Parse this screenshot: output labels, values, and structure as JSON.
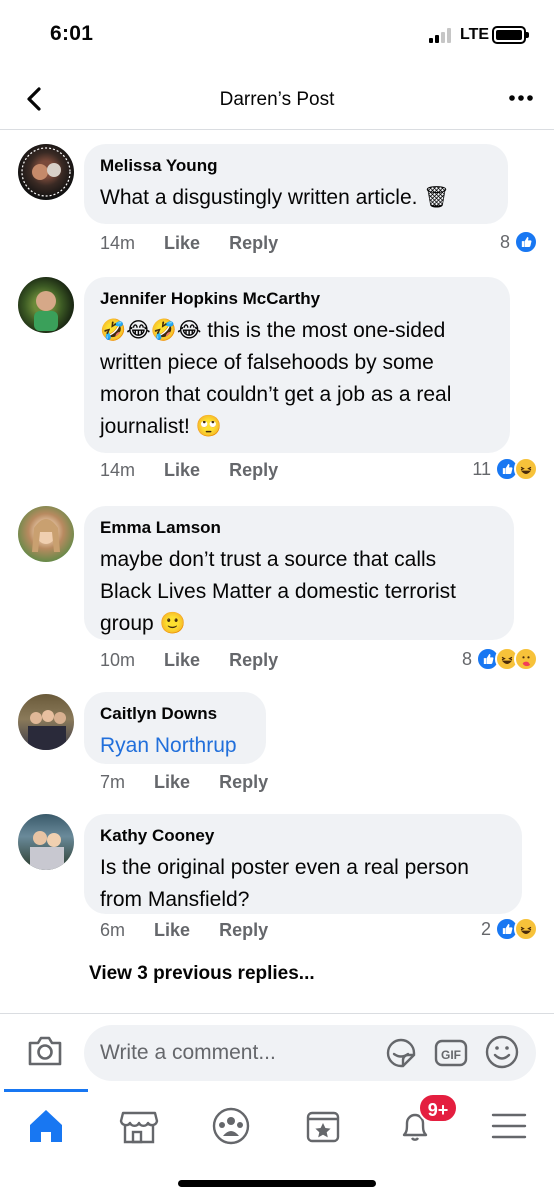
{
  "status_bar": {
    "time": "6:01",
    "network": "LTE"
  },
  "header": {
    "title": "Darren’s Post"
  },
  "comments": [
    {
      "author": "Melissa Young",
      "text": "What a disgustingly written article. 🗑",
      "time": "14m",
      "like_label": "Like",
      "reply_label": "Reply",
      "reaction_count": "8",
      "reactions": [
        "like"
      ]
    },
    {
      "author": "Jennifer Hopkins McCarthy",
      "text_line1": "this is the most one-sided",
      "text_line2": "written piece of falsehoods by some",
      "text_line3": "moron that couldn’t get a job as a real",
      "text_line4": "journalist!",
      "time": "14m",
      "like_label": "Like",
      "reply_label": "Reply",
      "reaction_count": "11",
      "reactions": [
        "like",
        "haha"
      ]
    },
    {
      "author": "Emma Lamson",
      "text_line1": "maybe don’t trust a source that calls",
      "text_line2": "Black Lives Matter a domestic terrorist",
      "text_line3": "group",
      "time": "10m",
      "like_label": "Like",
      "reply_label": "Reply",
      "reaction_count": "8",
      "reactions": [
        "like",
        "haha",
        "care"
      ]
    },
    {
      "author": "Caitlyn Downs",
      "text": "Ryan Northrup",
      "time": "7m",
      "like_label": "Like",
      "reply_label": "Reply"
    },
    {
      "author": "Kathy Cooney",
      "text_line1": "Is the original poster even a real person",
      "text_line2": "from Mansfield?",
      "time": "6m",
      "like_label": "Like",
      "reply_label": "Reply",
      "reaction_count": "2",
      "reactions": [
        "like",
        "haha"
      ]
    }
  ],
  "view_previous": "View 3 previous replies...",
  "composer": {
    "placeholder": "Write a comment..."
  },
  "tabbar": {
    "notifications_badge": "9+"
  },
  "colors": {
    "accent": "#1877f2",
    "bubble": "#f0f2f5",
    "badge": "#e41e3f",
    "mention": "#216fdb"
  },
  "icons": [
    "back-icon",
    "more-icon",
    "camera-icon",
    "sticker-icon",
    "gif-icon",
    "emoji-icon",
    "home-icon",
    "marketplace-icon",
    "groups-icon",
    "pages-icon",
    "notifications-icon",
    "menu-icon"
  ]
}
